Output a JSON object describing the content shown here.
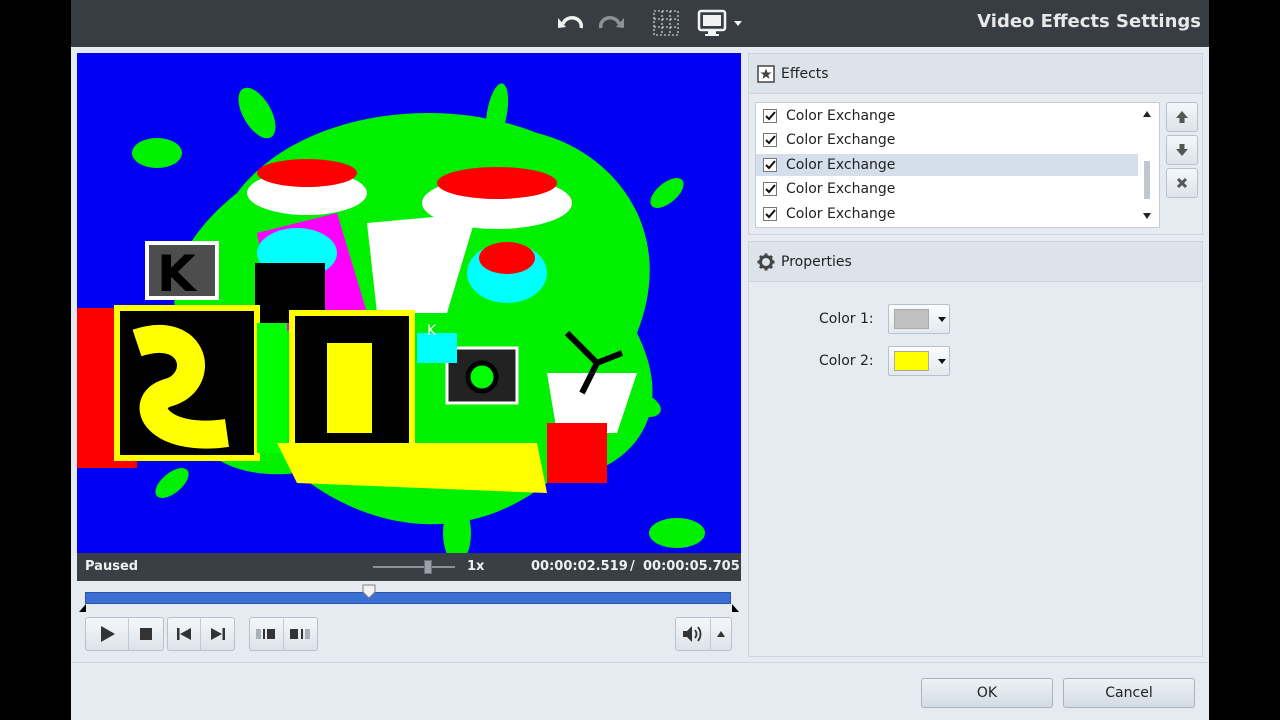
{
  "window": {
    "title": "Video Effects Settings"
  },
  "toolbar": {
    "undo_icon": "undo-icon",
    "redo_icon": "redo-icon",
    "grid_icon": "grid-icon",
    "monitor_icon": "monitor-icon"
  },
  "player": {
    "status": "Paused",
    "speed": "1x",
    "current_time": "00:00:02.519",
    "separator": "/",
    "total_time": "00:00:05.705",
    "progress": 0.44
  },
  "effects": {
    "header": "Effects",
    "items": [
      {
        "label": "Color Exchange",
        "checked": true,
        "selected": false
      },
      {
        "label": "Color Exchange",
        "checked": true,
        "selected": false
      },
      {
        "label": "Color Exchange",
        "checked": true,
        "selected": true
      },
      {
        "label": "Color Exchange",
        "checked": true,
        "selected": false
      },
      {
        "label": "Color Exchange",
        "checked": true,
        "selected": false
      }
    ]
  },
  "properties": {
    "header": "Properties",
    "color1_label": "Color 1:",
    "color1_value": "#c0c0c0",
    "color2_label": "Color 2:",
    "color2_value": "#ffff00"
  },
  "dialog": {
    "ok_label": "OK",
    "cancel_label": "Cancel"
  },
  "colors": {
    "accent": "#3c6fd4",
    "titlebar": "#383d44",
    "preview_bg": "#0000f5"
  }
}
